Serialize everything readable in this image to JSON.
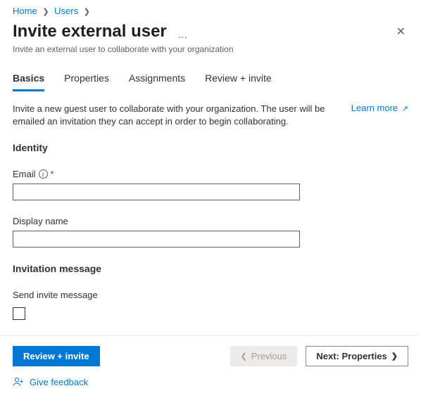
{
  "breadcrumb": {
    "home": "Home",
    "users": "Users"
  },
  "header": {
    "title": "Invite external user",
    "subtitle": "Invite an external user to collaborate with your organization"
  },
  "tabs": {
    "basics": "Basics",
    "properties": "Properties",
    "assignments": "Assignments",
    "review": "Review + invite"
  },
  "desc": "Invite a new guest user to collaborate with your organization. The user will be emailed an invitation they can accept in order to begin collaborating.",
  "learn_more": "Learn more",
  "sections": {
    "identity": "Identity",
    "invitation": "Invitation message"
  },
  "fields": {
    "email_label": "Email",
    "email_value": "",
    "display_label": "Display name",
    "display_value": "",
    "send_invite_label": "Send invite message"
  },
  "footer": {
    "review": "Review + invite",
    "previous": "Previous",
    "next": "Next: Properties"
  },
  "feedback": "Give feedback"
}
